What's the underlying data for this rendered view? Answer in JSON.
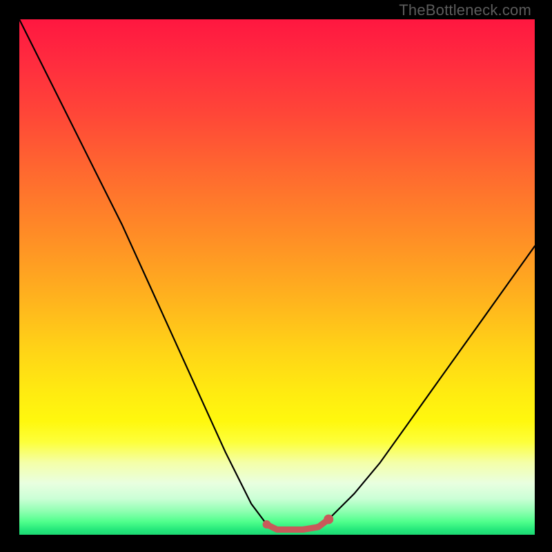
{
  "watermark": "TheBottleneck.com",
  "chart_data": {
    "type": "line",
    "title": "",
    "xlabel": "",
    "ylabel": "",
    "xlim": [
      0,
      100
    ],
    "ylim": [
      0,
      100
    ],
    "series": [
      {
        "name": "bottleneck-curve",
        "x": [
          0,
          5,
          10,
          15,
          20,
          25,
          30,
          35,
          40,
          45,
          48,
          50,
          52,
          55,
          58,
          60,
          62,
          65,
          70,
          75,
          80,
          85,
          90,
          95,
          100
        ],
        "values": [
          100,
          90,
          80,
          70,
          60,
          49,
          38,
          27,
          16,
          6,
          2,
          1,
          1,
          1,
          2,
          3,
          5,
          8,
          14,
          21,
          28,
          35,
          42,
          49,
          56
        ]
      },
      {
        "name": "flat-segment",
        "x": [
          48,
          50,
          52,
          55,
          58,
          60
        ],
        "values": [
          2,
          1,
          1,
          1,
          1.5,
          3
        ]
      }
    ],
    "colors": {
      "bottleneck-curve": "#000000",
      "flat-segment": "#c85a5a"
    },
    "background_gradient": [
      "#ff1740",
      "#ff6a2f",
      "#ffd317",
      "#fdff3a",
      "#4fff8c",
      "#1dd873"
    ]
  }
}
